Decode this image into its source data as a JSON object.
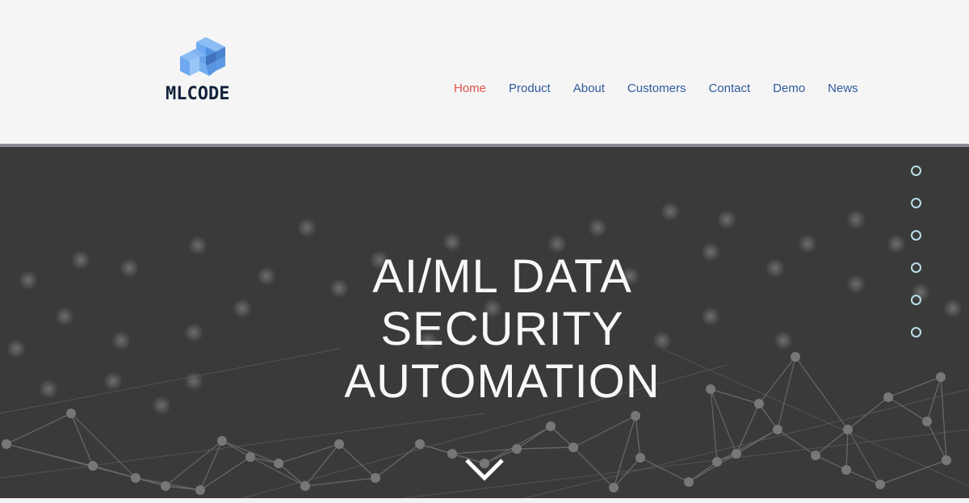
{
  "brand": {
    "name": "MLCODE",
    "logo_icon": "stacked-cubes-icon",
    "colors": {
      "logo_light": "#6ea8f0",
      "logo_mid": "#5090e0",
      "logo_dark": "#3f72bf",
      "wordmark": "#13223b"
    }
  },
  "nav": {
    "items": [
      {
        "label": "Home",
        "active": true
      },
      {
        "label": "Product",
        "active": false
      },
      {
        "label": "About",
        "active": false
      },
      {
        "label": "Customers",
        "active": false
      },
      {
        "label": "Contact",
        "active": false
      },
      {
        "label": "Demo",
        "active": false
      },
      {
        "label": "News",
        "active": false
      }
    ],
    "colors": {
      "active": "#e2534a",
      "default": "#2f5a9a"
    }
  },
  "hero": {
    "headline_lines": [
      "AI/ML DATA",
      "SECURITY",
      "AUTOMATION"
    ],
    "background": "network-graph-image",
    "scroll_icon": "chevron-down-icon",
    "section_dots": [
      {
        "index": 1,
        "active": false
      },
      {
        "index": 2,
        "active": false
      },
      {
        "index": 3,
        "active": false
      },
      {
        "index": 4,
        "active": false
      },
      {
        "index": 5,
        "active": false
      },
      {
        "index": 6,
        "active": false
      }
    ],
    "colors": {
      "background": "#3a3a3a",
      "text": "#f7f7f7",
      "dot": "#b8dfe6"
    }
  }
}
